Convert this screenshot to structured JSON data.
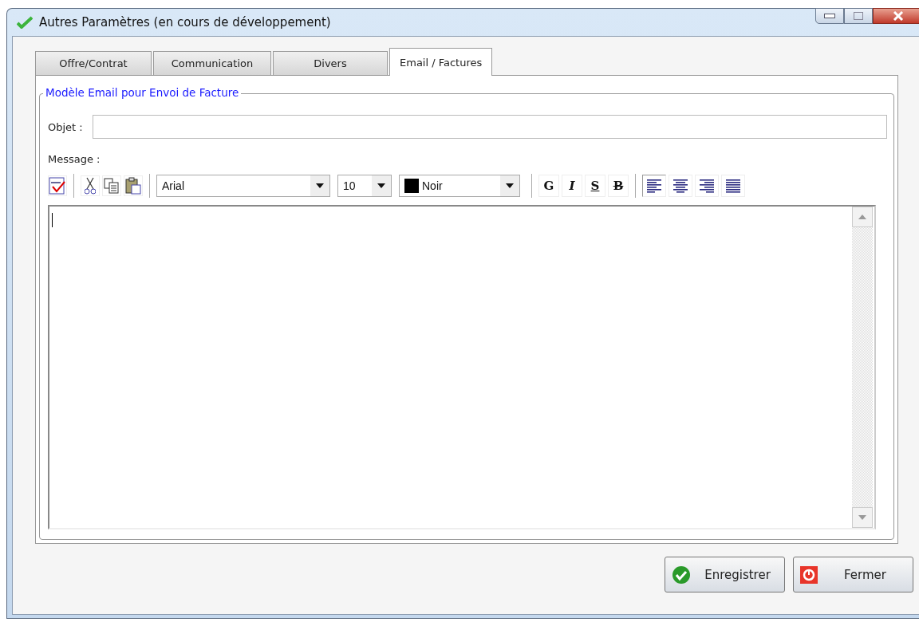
{
  "window": {
    "title": "Autres Paramètres (en cours de développement)"
  },
  "tabs": [
    {
      "label": "Offre/Contrat",
      "selected": false
    },
    {
      "label": "Communication",
      "selected": false
    },
    {
      "label": "Divers",
      "selected": false
    },
    {
      "label": "Email / Factures",
      "selected": true
    }
  ],
  "group": {
    "legend": "Modèle Email pour Envoi de Facture"
  },
  "subject": {
    "label": "Objet :"
  },
  "message": {
    "label": "Message :"
  },
  "toolbar": {
    "font": "Arial",
    "size": "10",
    "color": {
      "label": "Noir",
      "color": "#000000"
    },
    "format_buttons": [
      {
        "label": "G",
        "kind": "bold"
      },
      {
        "label": "I",
        "kind": "italic"
      },
      {
        "label": "S",
        "kind": "underline"
      },
      {
        "label": "B",
        "kind": "strike"
      }
    ],
    "alignments": [
      {
        "kind": "left",
        "selected": true
      },
      {
        "kind": "center",
        "selected": false
      },
      {
        "kind": "right",
        "selected": false
      },
      {
        "kind": "justify",
        "selected": false
      }
    ]
  },
  "buttons": [
    {
      "label": "Enregistrer",
      "kind": "save"
    },
    {
      "label": "Fermer",
      "kind": "close"
    }
  ]
}
